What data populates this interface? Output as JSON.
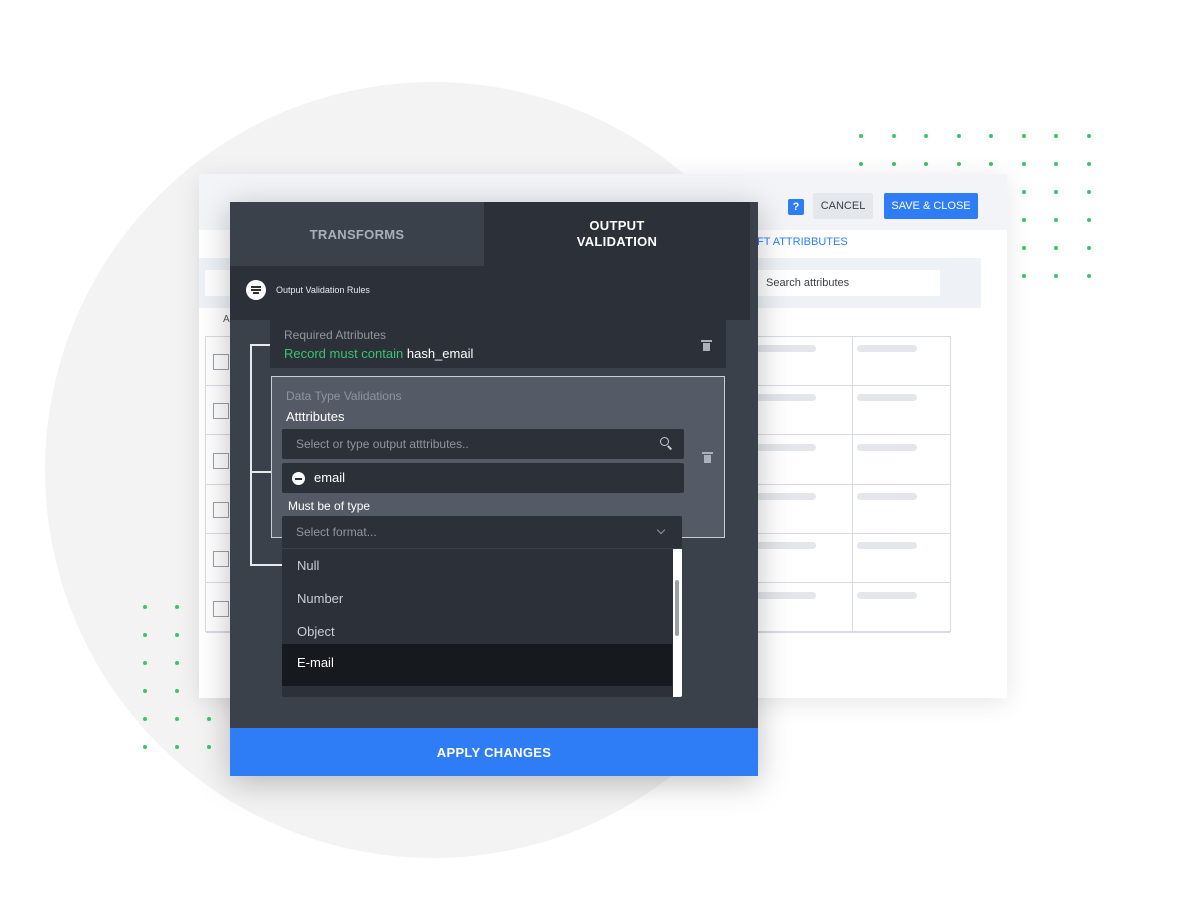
{
  "header": {
    "help_icon_label": "?",
    "cancel_label": "CANCEL",
    "save_close_label": "SAVE & CLOSE"
  },
  "background": {
    "left_attributes_tab": "FT ATTRIBBUTES",
    "search_attributes_label": "Search attributes",
    "column_letter": "A",
    "table_row_count": 6
  },
  "tabs": {
    "transforms": "TRANSFORMS",
    "output_validation": "OUTPUT VALIDATION"
  },
  "rules_bar": {
    "label": "Output Validation Rules",
    "icon": "filter-lines-icon"
  },
  "required_attributes": {
    "title": "Required Attributes",
    "rule_prefix": "Record must contain",
    "attribute": "hash_email"
  },
  "data_type_validations": {
    "title": "Data Type Validations",
    "attributes_label": "Atttributes",
    "search_placeholder": "Select or type output atttributes..",
    "selected_attribute": "email",
    "type_label": "Must be of type",
    "select_placeholder": "Select format..."
  },
  "type_options": {
    "items": [
      {
        "label": "Null",
        "active": false
      },
      {
        "label": "Number",
        "active": false
      },
      {
        "label": "Object",
        "active": false
      },
      {
        "label": "E-mail",
        "active": true
      }
    ]
  },
  "footer": {
    "apply_label": "APPLY CHANGES"
  },
  "colors": {
    "accent_blue": "#2f7df6",
    "success_green": "#3cc36b",
    "panel_dark": "#3a414b",
    "panel_darker": "#2c3139"
  }
}
